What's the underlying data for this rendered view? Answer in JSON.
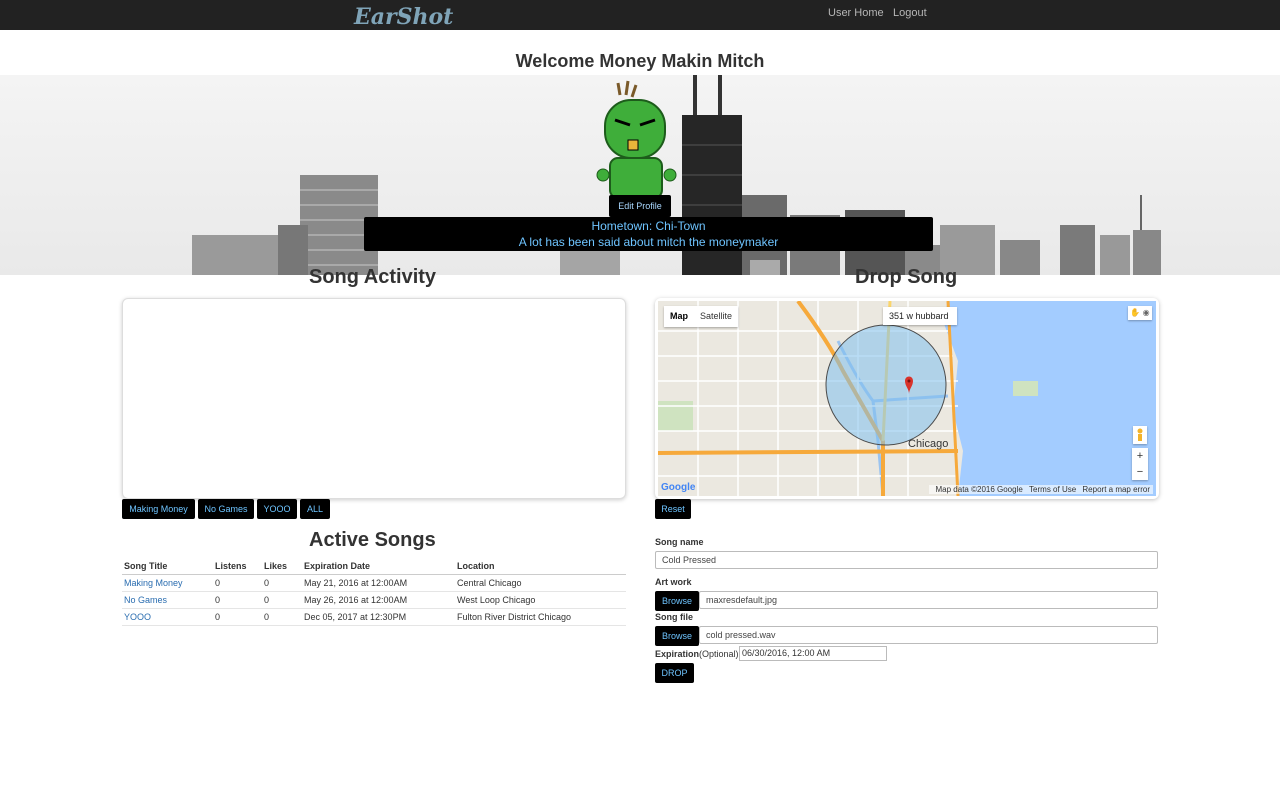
{
  "nav": {
    "brand": "EarShot",
    "user_home": "User Home",
    "logout": "Logout"
  },
  "welcome": "Welcome Money Makin Mitch",
  "profile": {
    "edit_label": "Edit Profile",
    "hometown": "Hometown: Chi-Town",
    "bio": "A lot has been said about mitch the moneymaker"
  },
  "sections": {
    "song_activity": "Song Activity",
    "drop_song": "Drop Song",
    "active_songs": "Active Songs"
  },
  "filters": [
    "Making Money",
    "No Games",
    "YOOO",
    "ALL"
  ],
  "table": {
    "headers": [
      "Song Title",
      "Listens",
      "Likes",
      "Expiration Date",
      "Location"
    ],
    "rows": [
      [
        "Making Money",
        "0",
        "0",
        "May 21, 2016 at 12:00AM",
        "Central Chicago"
      ],
      [
        "No Games",
        "0",
        "0",
        "May 26, 2016 at 12:00AM",
        "West Loop Chicago"
      ],
      [
        "YOOO",
        "0",
        "0",
        "Dec 05, 2017 at 12:30PM",
        "Fulton River District Chicago"
      ]
    ]
  },
  "map": {
    "type_map": "Map",
    "type_satellite": "Satellite",
    "search_value": "351 w hubbard",
    "city_label": "Chicago",
    "data_credit": "Map data ©2016 Google",
    "terms": "Terms of Use",
    "report": "Report a map error",
    "google": "Google",
    "zoom_in": "+",
    "zoom_out": "−"
  },
  "form": {
    "reset": "Reset",
    "song_name_label": "Song name",
    "song_name_value": "Cold Pressed",
    "artwork_label": "Art work",
    "browse": "Browse",
    "artwork_file": "maxresdefault.jpg",
    "song_file_label": "Song file",
    "song_file": "cold pressed.wav",
    "expiration_label": "Expiration",
    "optional": "(Optional)",
    "expiration_value": "06/30/2016, 12:00 AM",
    "drop": "DROP"
  },
  "colors": {
    "navbar": "#222222",
    "accent_text": "#6ec4ff",
    "link": "#2a6db0",
    "map_water": "#a3ccff",
    "circle": "#7fc0ee"
  }
}
